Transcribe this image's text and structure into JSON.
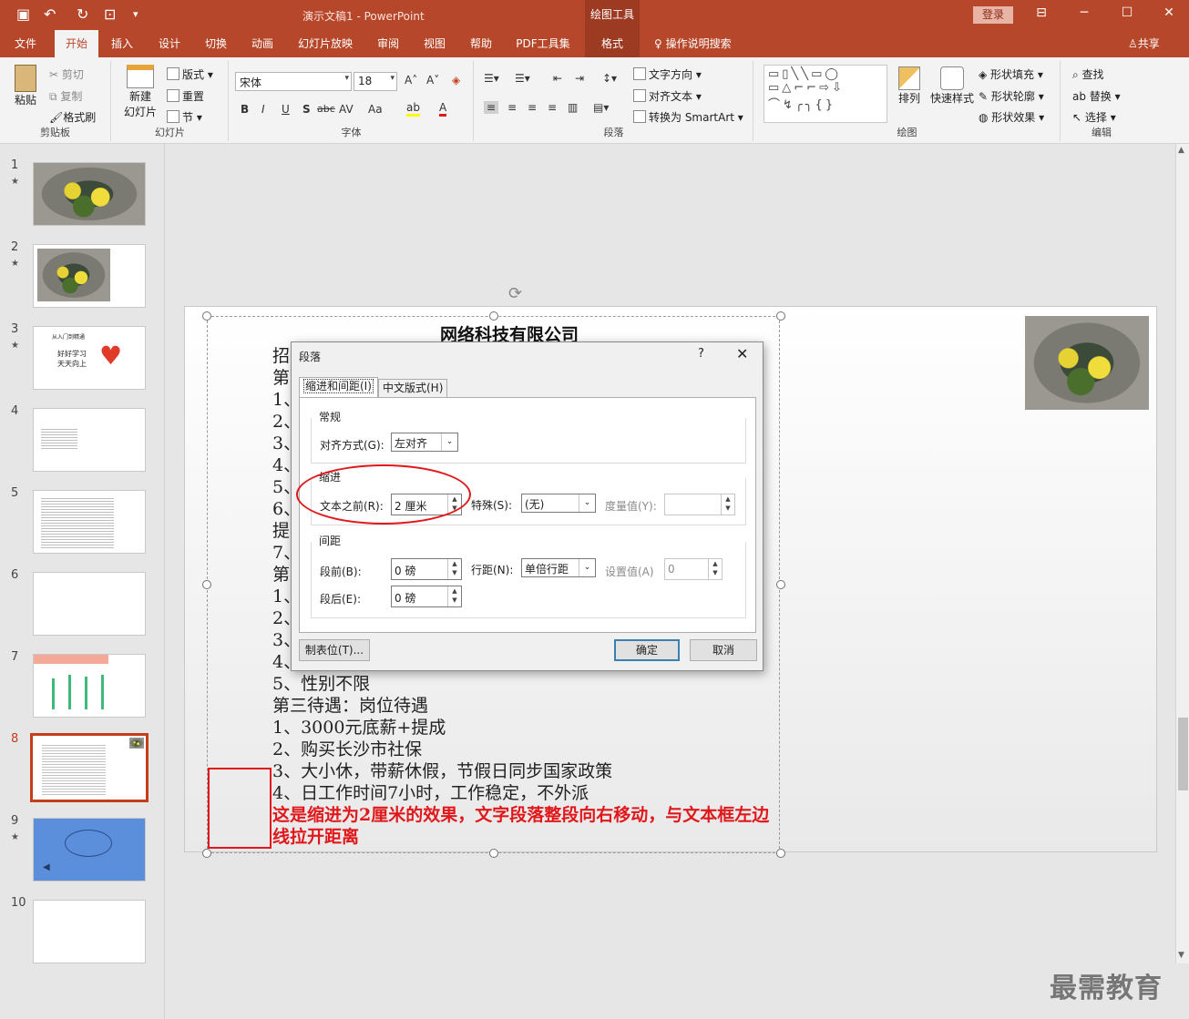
{
  "window": {
    "title": "演示文稿1  -  PowerPoint",
    "context_tools": "绘图工具",
    "login": "登录"
  },
  "tabs": [
    "文件",
    "开始",
    "插入",
    "设计",
    "切换",
    "动画",
    "幻灯片放映",
    "审阅",
    "视图",
    "帮助",
    "PDF工具集",
    "格式"
  ],
  "active_tab": "开始",
  "tell_me": "操作说明搜索",
  "share": "共享",
  "ribbon": {
    "clipboard": {
      "label": "剪贴板",
      "paste": "粘贴",
      "cut": "剪切",
      "copy": "复制",
      "format_painter": "格式刷"
    },
    "slides": {
      "label": "幻灯片",
      "new_slide": "新建",
      "new_slide2": "幻灯片",
      "layout": "版式",
      "reset": "重置",
      "section": "节"
    },
    "font": {
      "label": "字体",
      "font_name": "宋体",
      "font_size": "18",
      "bold": "B",
      "italic": "I",
      "underline": "U",
      "shadow": "S",
      "strike": "abc",
      "spacing": "AV",
      "case": "Aa"
    },
    "paragraph": {
      "label": "段落",
      "text_direction": "文字方向",
      "align_text": "对齐文本",
      "smartart": "转换为 SmartArt"
    },
    "drawing": {
      "label": "绘图",
      "arrange": "排列",
      "quick_styles": "快速样式",
      "shape_fill": "形状填充",
      "shape_outline": "形状轮廓",
      "shape_effects": "形状效果"
    },
    "editing": {
      "label": "编辑",
      "find": "查找",
      "replace": "替换",
      "select": "选择"
    }
  },
  "thumbnails": [
    {
      "num": "1",
      "star": "★"
    },
    {
      "num": "2",
      "star": "★"
    },
    {
      "num": "3",
      "star": "★",
      "line1": "从入门到精通",
      "line2": "好好学习",
      "line3": "天天向上"
    },
    {
      "num": "4",
      "star": ""
    },
    {
      "num": "5",
      "star": ""
    },
    {
      "num": "6",
      "star": ""
    },
    {
      "num": "7",
      "star": ""
    },
    {
      "num": "8",
      "star": ""
    },
    {
      "num": "9",
      "star": "★"
    },
    {
      "num": "10",
      "star": ""
    }
  ],
  "selected_slide": "8",
  "slide": {
    "title": "网络科技有限公司",
    "lines_left": [
      "招",
      "第",
      "1、",
      "2、",
      "3、",
      "4、",
      "5、",
      "6、",
      "提",
      "7、",
      "第",
      "1、",
      "2、",
      "3、",
      "4、"
    ],
    "lines_full": [
      "5、性别不限",
      "第三待遇：岗位待遇",
      "1、3000元底薪+提成",
      "2、购买长沙市社保",
      "3、大小休，带薪休假，节假日同步国家政策",
      "4、日工作时间7小时，工作稳定，不外派"
    ],
    "note": "这是缩进为2厘米的效果，文字段落整段向右移动，与文本框左边线拉开距离"
  },
  "dialog": {
    "title": "段落",
    "help": "?",
    "close": "✕",
    "tab1": "缩进和间距(I)",
    "tab2": "中文版式(H)",
    "general": "常规",
    "alignment_label": "对齐方式(G):",
    "alignment_value": "左对齐",
    "indent": "缩进",
    "before_text_label": "文本之前(R):",
    "before_text_value": "2 厘米",
    "special_label": "特殊(S):",
    "special_value": "(无)",
    "by_label": "度量值(Y):",
    "by_value": "",
    "spacing": "间距",
    "before_label": "段前(B):",
    "before_value": "0 磅",
    "after_label": "段后(E):",
    "after_value": "0 磅",
    "line_spacing_label": "行距(N):",
    "line_spacing_value": "单倍行距",
    "at_label": "设置值(A)",
    "at_value": "0",
    "tabs_button": "制表位(T)...",
    "ok": "确定",
    "cancel": "取消"
  },
  "watermark": "最需教育"
}
